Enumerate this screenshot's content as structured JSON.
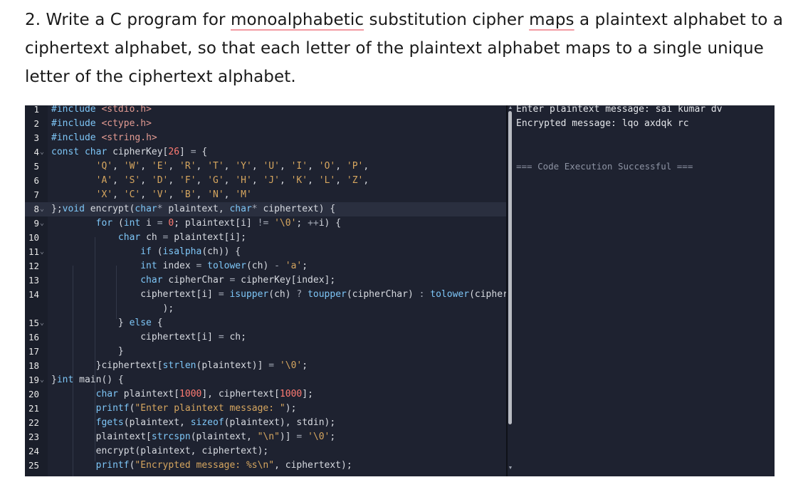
{
  "question": {
    "part1": "2. Write a C program for ",
    "word1": "monoalphabetic",
    "part2": " substitution cipher ",
    "word2": "maps",
    "part3": " a plaintext alphabet to a ciphertext alphabet, so that each letter of the plaintext alphabet maps to a single unique letter of the ciphertext alphabet."
  },
  "editor": {
    "lines": [
      {
        "n": "1",
        "fold": false,
        "tokens": [
          [
            "pre",
            "#include "
          ],
          [
            "inc",
            "<stdio.h>"
          ]
        ]
      },
      {
        "n": "2",
        "fold": false,
        "tokens": [
          [
            "pre",
            "#include "
          ],
          [
            "inc",
            "<ctype.h>"
          ]
        ]
      },
      {
        "n": "3",
        "fold": false,
        "tokens": [
          [
            "pre",
            "#include "
          ],
          [
            "inc",
            "<string.h>"
          ]
        ]
      },
      {
        "n": "4",
        "fold": true,
        "tokens": [
          [
            "kw",
            "const char "
          ],
          [
            "",
            "cipherKey["
          ],
          [
            "num",
            "26"
          ],
          [
            "",
            "] "
          ],
          [
            "op",
            "="
          ],
          [
            "",
            " {"
          ]
        ]
      },
      {
        "n": "5",
        "fold": false,
        "tokens": [
          [
            "",
            "        "
          ],
          [
            "str",
            "'Q'"
          ],
          [
            "",
            ", "
          ],
          [
            "str",
            "'W'"
          ],
          [
            "",
            ", "
          ],
          [
            "str",
            "'E'"
          ],
          [
            "",
            ", "
          ],
          [
            "str",
            "'R'"
          ],
          [
            "",
            ", "
          ],
          [
            "str",
            "'T'"
          ],
          [
            "",
            ", "
          ],
          [
            "str",
            "'Y'"
          ],
          [
            "",
            ", "
          ],
          [
            "str",
            "'U'"
          ],
          [
            "",
            ", "
          ],
          [
            "str",
            "'I'"
          ],
          [
            "",
            ", "
          ],
          [
            "str",
            "'O'"
          ],
          [
            "",
            ", "
          ],
          [
            "str",
            "'P'"
          ],
          [
            "",
            ","
          ]
        ]
      },
      {
        "n": "6",
        "fold": false,
        "tokens": [
          [
            "",
            "        "
          ],
          [
            "str",
            "'A'"
          ],
          [
            "",
            ", "
          ],
          [
            "str",
            "'S'"
          ],
          [
            "",
            ", "
          ],
          [
            "str",
            "'D'"
          ],
          [
            "",
            ", "
          ],
          [
            "str",
            "'F'"
          ],
          [
            "",
            ", "
          ],
          [
            "str",
            "'G'"
          ],
          [
            "",
            ", "
          ],
          [
            "str",
            "'H'"
          ],
          [
            "",
            ", "
          ],
          [
            "str",
            "'J'"
          ],
          [
            "",
            ", "
          ],
          [
            "str",
            "'K'"
          ],
          [
            "",
            ", "
          ],
          [
            "str",
            "'L'"
          ],
          [
            "",
            ", "
          ],
          [
            "str",
            "'Z'"
          ],
          [
            "",
            ","
          ]
        ]
      },
      {
        "n": "7",
        "fold": false,
        "tokens": [
          [
            "",
            "        "
          ],
          [
            "str",
            "'X'"
          ],
          [
            "",
            ", "
          ],
          [
            "str",
            "'C'"
          ],
          [
            "",
            ", "
          ],
          [
            "str",
            "'V'"
          ],
          [
            "",
            ", "
          ],
          [
            "str",
            "'B'"
          ],
          [
            "",
            ", "
          ],
          [
            "str",
            "'N'"
          ],
          [
            "",
            ", "
          ],
          [
            "str",
            "'M'"
          ]
        ]
      },
      {
        "n": "8",
        "fold": true,
        "hl": true,
        "tokens": [
          [
            "",
            "};"
          ],
          [
            "kw",
            "void "
          ],
          [
            "",
            "encrypt("
          ],
          [
            "kw",
            "char"
          ],
          [
            "op",
            "* "
          ],
          [
            "",
            "plaintext, "
          ],
          [
            "kw",
            "char"
          ],
          [
            "op",
            "* "
          ],
          [
            "",
            "ciphertext) {"
          ]
        ]
      },
      {
        "n": "9",
        "fold": true,
        "tokens": [
          [
            "",
            "        "
          ],
          [
            "kw",
            "for "
          ],
          [
            "",
            "("
          ],
          [
            "kw",
            "int "
          ],
          [
            "",
            "i "
          ],
          [
            "op",
            "= "
          ],
          [
            "num",
            "0"
          ],
          [
            "",
            "; plaintext[i] "
          ],
          [
            "op",
            "!= "
          ],
          [
            "str",
            "'\\0'"
          ],
          [
            "",
            "; "
          ],
          [
            "op",
            "++"
          ],
          [
            "",
            "i) {"
          ]
        ]
      },
      {
        "n": "10",
        "fold": false,
        "tokens": [
          [
            "",
            "            "
          ],
          [
            "kw",
            "char "
          ],
          [
            "",
            "ch "
          ],
          [
            "op",
            "= "
          ],
          [
            "",
            "plaintext[i];"
          ]
        ]
      },
      {
        "n": "11",
        "fold": true,
        "tokens": [
          [
            "",
            "                "
          ],
          [
            "kw",
            "if "
          ],
          [
            "",
            "("
          ],
          [
            "fn",
            "isalpha"
          ],
          [
            "",
            "(ch)) {"
          ]
        ]
      },
      {
        "n": "12",
        "fold": false,
        "tokens": [
          [
            "",
            "                "
          ],
          [
            "kw",
            "int "
          ],
          [
            "",
            "index "
          ],
          [
            "op",
            "= "
          ],
          [
            "fn",
            "tolower"
          ],
          [
            "",
            "(ch) "
          ],
          [
            "op",
            "- "
          ],
          [
            "str",
            "'a'"
          ],
          [
            "",
            ";"
          ]
        ]
      },
      {
        "n": "13",
        "fold": false,
        "tokens": [
          [
            "",
            "                "
          ],
          [
            "kw",
            "char "
          ],
          [
            "",
            "cipherChar "
          ],
          [
            "op",
            "= "
          ],
          [
            "",
            "cipherKey[index];"
          ]
        ]
      },
      {
        "n": "14",
        "fold": false,
        "tokens": [
          [
            "",
            "                "
          ],
          [
            "",
            "ciphertext[i] "
          ],
          [
            "op",
            "= "
          ],
          [
            "fn",
            "isupper"
          ],
          [
            "",
            "(ch) "
          ],
          [
            "op",
            "? "
          ],
          [
            "fn",
            "toupper"
          ],
          [
            "",
            "(cipherChar) "
          ],
          [
            "op",
            ": "
          ],
          [
            "fn",
            "tolower"
          ],
          [
            "",
            "(cipherChar"
          ]
        ]
      },
      {
        "n": "",
        "fold": false,
        "tokens": [
          [
            "",
            "                    );"
          ]
        ]
      },
      {
        "n": "15",
        "fold": true,
        "tokens": [
          [
            "",
            "            } "
          ],
          [
            "kw",
            "else "
          ],
          [
            "",
            "{"
          ]
        ]
      },
      {
        "n": "16",
        "fold": false,
        "tokens": [
          [
            "",
            "                ciphertext[i] "
          ],
          [
            "op",
            "= "
          ],
          [
            "",
            "ch;"
          ]
        ]
      },
      {
        "n": "17",
        "fold": false,
        "tokens": [
          [
            "",
            "            }"
          ]
        ]
      },
      {
        "n": "18",
        "fold": false,
        "tokens": [
          [
            "",
            "        }ciphertext["
          ],
          [
            "fn",
            "strlen"
          ],
          [
            "",
            "(plaintext)] "
          ],
          [
            "op",
            "= "
          ],
          [
            "str",
            "'\\0'"
          ],
          [
            "",
            ";"
          ]
        ]
      },
      {
        "n": "19",
        "fold": true,
        "tokens": [
          [
            "",
            "}"
          ],
          [
            "kw",
            "int "
          ],
          [
            "",
            "main() {"
          ]
        ]
      },
      {
        "n": "20",
        "fold": false,
        "tokens": [
          [
            "",
            "        "
          ],
          [
            "kw",
            "char "
          ],
          [
            "",
            "plaintext["
          ],
          [
            "num",
            "1000"
          ],
          [
            "",
            "], ciphertext["
          ],
          [
            "num",
            "1000"
          ],
          [
            "",
            "];"
          ]
        ]
      },
      {
        "n": "21",
        "fold": false,
        "tokens": [
          [
            "",
            "        "
          ],
          [
            "fn",
            "printf"
          ],
          [
            "",
            "("
          ],
          [
            "str",
            "\"Enter plaintext message: \""
          ],
          [
            "",
            ");"
          ]
        ]
      },
      {
        "n": "22",
        "fold": false,
        "tokens": [
          [
            "",
            "        "
          ],
          [
            "fn",
            "fgets"
          ],
          [
            "",
            "(plaintext, "
          ],
          [
            "kw",
            "sizeof"
          ],
          [
            "",
            "(plaintext), stdin);"
          ]
        ]
      },
      {
        "n": "23",
        "fold": false,
        "tokens": [
          [
            "",
            "        plaintext["
          ],
          [
            "fn",
            "strcspn"
          ],
          [
            "",
            "(plaintext, "
          ],
          [
            "str",
            "\"\\n\""
          ],
          [
            "",
            ")] "
          ],
          [
            "op",
            "= "
          ],
          [
            "str",
            "'\\0'"
          ],
          [
            "",
            ";"
          ]
        ]
      },
      {
        "n": "24",
        "fold": false,
        "tokens": [
          [
            "",
            "        encrypt(plaintext, ciphertext);"
          ]
        ]
      },
      {
        "n": "25",
        "fold": false,
        "tokens": [
          [
            "",
            "        "
          ],
          [
            "fn",
            "printf"
          ],
          [
            "",
            "("
          ],
          [
            "str",
            "\"Encrypted message: %s\\n\""
          ],
          [
            "",
            ", ciphertext);"
          ]
        ]
      }
    ]
  },
  "output": {
    "line1": "Enter plaintext message: sai kumar dv",
    "line2": "Encrypted message: lqo axdqk rc",
    "success": "=== Code Execution Successful ==="
  },
  "icons": {
    "scroll_up": "▲",
    "scroll_down": "▼",
    "fold": "⌄"
  }
}
